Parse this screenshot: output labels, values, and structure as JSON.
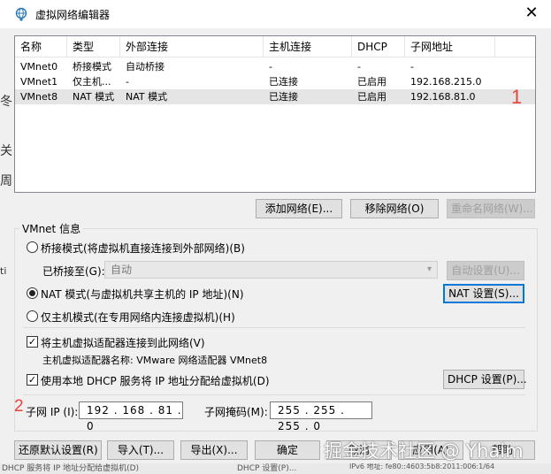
{
  "window": {
    "title": "虚拟网络编辑器",
    "close_symbol": "✕"
  },
  "background_fragments": {
    "frag1": "冬",
    "frag2": "关",
    "frag3": "周",
    "frag4": "ti",
    "bottom_status": "DHCP 服务将 IP 地址分配给虚拟机(D)",
    "bottom_status2": "DHCP 设置(P)...",
    "bottom_status3": "IPv6 地址: fe80::4603:5b8:2011:006:1/64"
  },
  "table": {
    "headers": [
      "名称",
      "类型",
      "外部连接",
      "主机连接",
      "DHCP",
      "子网地址"
    ],
    "rows": [
      [
        "VMnet0",
        "桥接模式",
        "自动桥接",
        "-",
        "-",
        "-"
      ],
      [
        "VMnet1",
        "仅主机...",
        "-",
        "已连接",
        "已启用",
        "192.168.215.0"
      ],
      [
        "VMnet8",
        "NAT 模式",
        "NAT 模式",
        "已连接",
        "已启用",
        "192.168.81.0"
      ]
    ],
    "selected_row": 2
  },
  "annotations": {
    "one": "1",
    "two": "2"
  },
  "table_buttons": {
    "add": "添加网络(E)...",
    "remove": "移除网络(O)",
    "rename": "重命名网络(W)..."
  },
  "vmnet_info": {
    "group_label": "VMnet 信息",
    "bridge_label": "桥接模式(将虚拟机直接连接到外部网络)(B)",
    "bridged_to_label": "已桥接至(G):",
    "bridged_to_value": "自动",
    "auto_settings_button": "自动设置(U)...",
    "nat_label": "NAT 模式(与虚拟机共享主机的 IP 地址)(N)",
    "nat_settings_button": "NAT 设置(S)...",
    "hostonly_label": "仅主机模式(在专用网络内连接虚拟机)(H)",
    "connect_adapter_label": "将主机虚拟适配器连接到此网络(V)",
    "adapter_name_label": "主机虚拟适配器名称: VMware 网络适配器 VMnet8",
    "dhcp_label": "使用本地 DHCP 服务将 IP 地址分配给虚拟机(D)",
    "dhcp_settings_button": "DHCP 设置(P)...",
    "subnet_ip_label": "子网 IP (I):",
    "subnet_ip_value": "192 . 168 . 81 . 0",
    "subnet_mask_label": "子网掩码(M):",
    "subnet_mask_value": "255 . 255 . 255 . 0",
    "selected_mode": "nat",
    "connect_adapter_checked": true,
    "dhcp_checked": true
  },
  "footer_buttons": {
    "restore": "还原默认设置(R)",
    "import": "导入(T)...",
    "export": "导出(X)...",
    "ok": "确定",
    "cancel": "取消",
    "apply": "应用(A)",
    "help": "帮助"
  },
  "watermark": "掘金技术社区 @ Yhaim",
  "colors": {
    "accent": "#0078d7",
    "annotation": "#e8433d"
  }
}
